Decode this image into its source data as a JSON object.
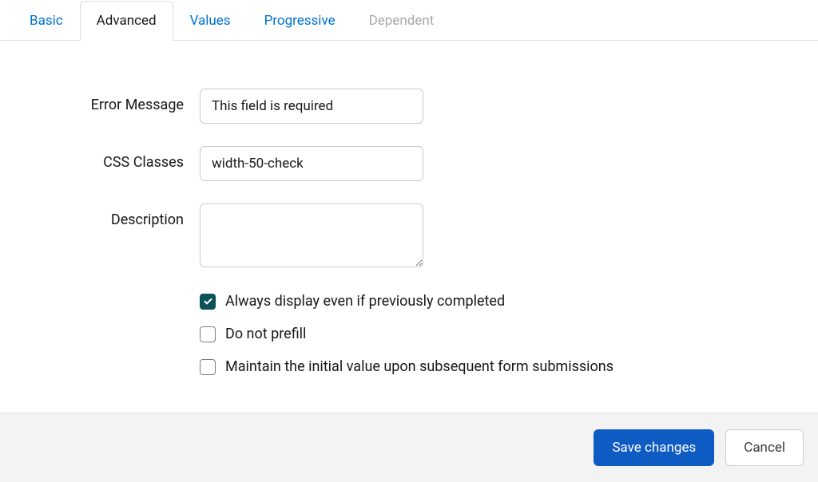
{
  "tabs": {
    "basic": "Basic",
    "advanced": "Advanced",
    "values": "Values",
    "progressive": "Progressive",
    "dependent": "Dependent"
  },
  "form": {
    "error_message": {
      "label": "Error Message",
      "value": "This field is required"
    },
    "css_classes": {
      "label": "CSS Classes",
      "value": "width-50-check"
    },
    "description": {
      "label": "Description",
      "value": ""
    }
  },
  "checkboxes": {
    "always_display": {
      "label": "Always display even if previously completed",
      "checked": true
    },
    "do_not_prefill": {
      "label": "Do not prefill",
      "checked": false
    },
    "maintain_initial": {
      "label": "Maintain the initial value upon subsequent form submissions",
      "checked": false
    }
  },
  "footer": {
    "save": "Save changes",
    "cancel": "Cancel"
  }
}
